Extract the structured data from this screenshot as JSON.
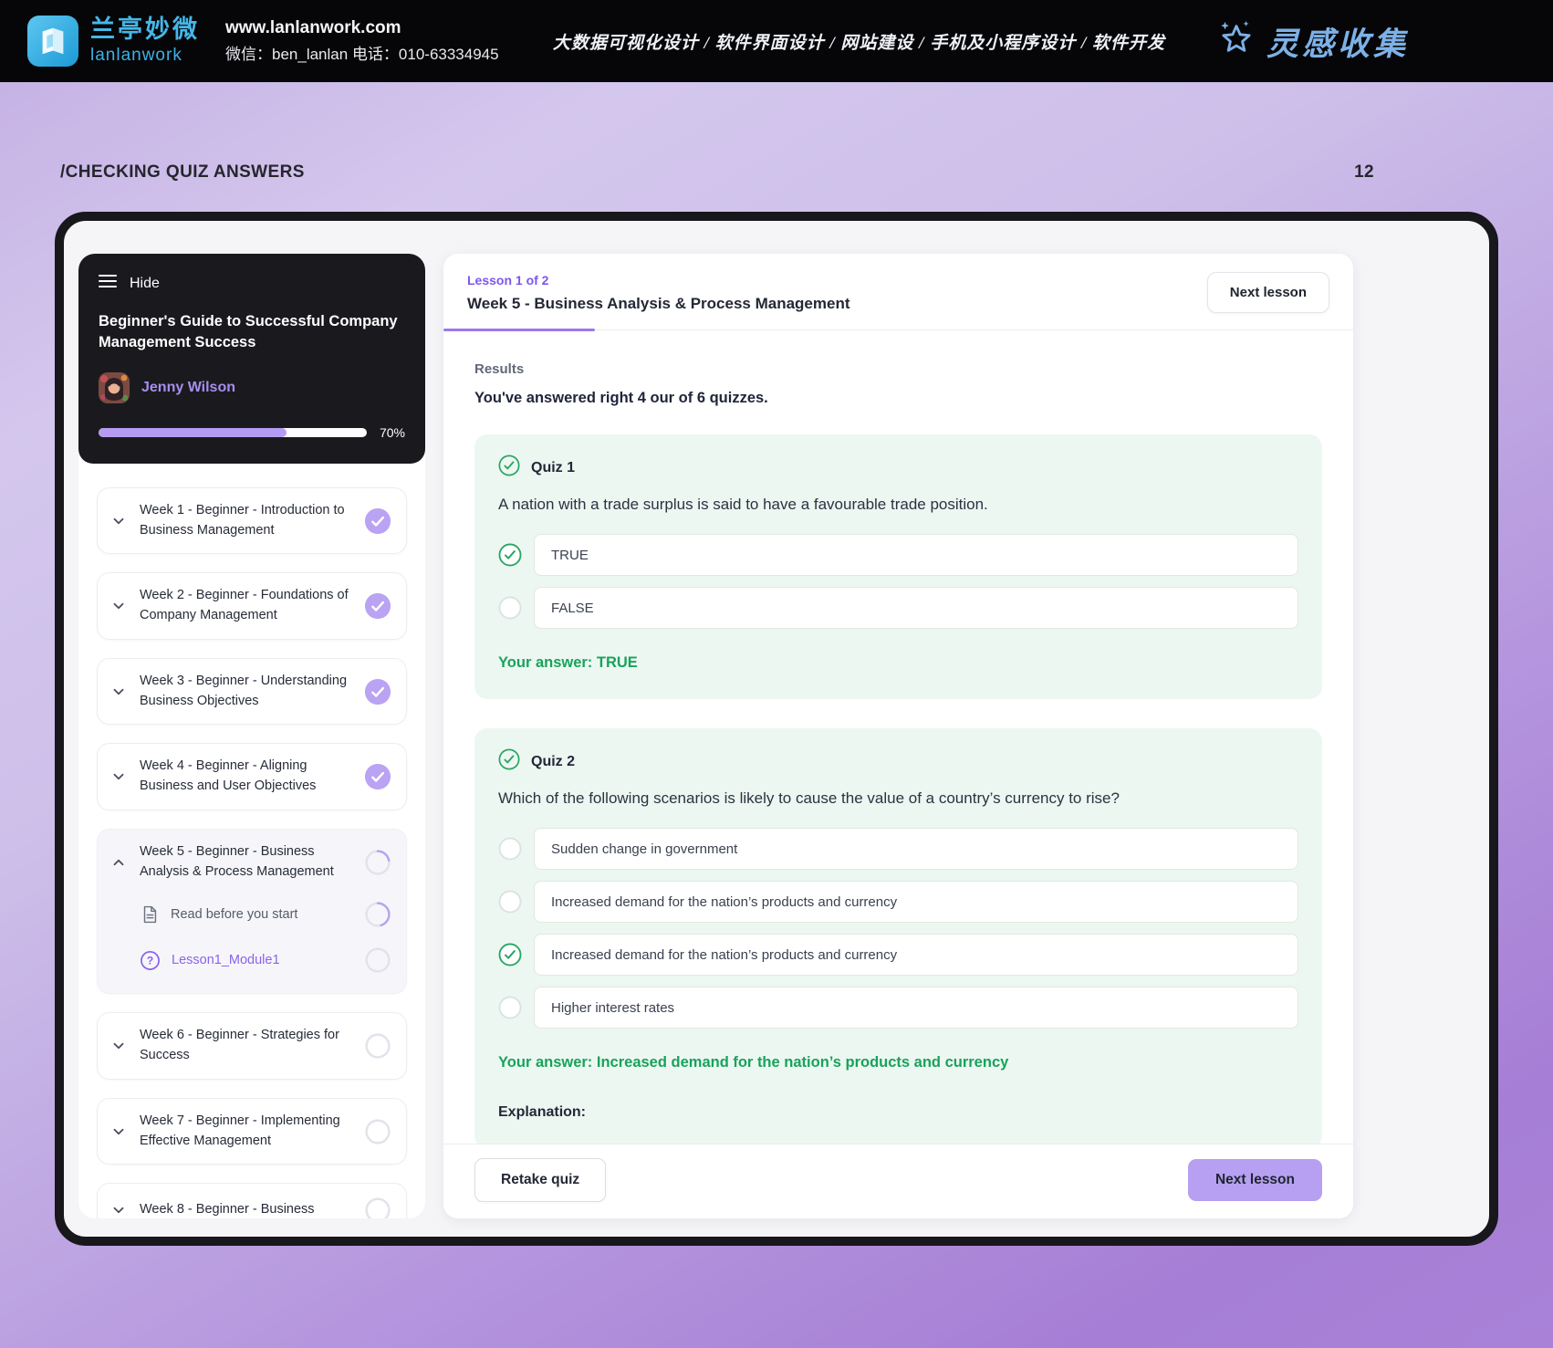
{
  "topbar": {
    "brand_cn": "兰亭妙微",
    "brand_en": "lanlanwork",
    "website": "www.lanlanwork.com",
    "contact": "微信：ben_lanlan    电话：010-63334945",
    "services": "大数据可视化设计 / 软件界面设计 / 网站建设 / 手机及小程序设计 / 软件开发",
    "collect_label": "灵感收集"
  },
  "page_label": "/CHECKING QUIZ ANSWERS",
  "page_number": "12",
  "colors": {
    "accent_purple": "#9b79ee",
    "light_purple": "#b7a0f2",
    "success_green": "#2aa564",
    "answer_green": "#17a35b",
    "quiz_card_bg": "#edf7f1",
    "brand_blue": "#45b7e9",
    "collect_blue": "#7db1e7"
  },
  "sidebar": {
    "hide_label": "Hide",
    "course_title": "Beginner's Guide to Successful Company Management Success",
    "instructor": "Jenny Wilson",
    "progress_value": 70,
    "progress_percent": "70%",
    "weeks": [
      {
        "label": "Week 1 - Beginner - Introduction to Business Management",
        "status": "completed",
        "expanded": false
      },
      {
        "label": "Week 2 - Beginner - Foundations of Company Management",
        "status": "completed",
        "expanded": false
      },
      {
        "label": "Week 3 - Beginner - Understanding Business Objectives",
        "status": "completed",
        "expanded": false
      },
      {
        "label": "Week 4 - Beginner - Aligning Business and User Objectives",
        "status": "completed",
        "expanded": false
      },
      {
        "label": "Week 5 - Beginner - Business Analysis & Process Management",
        "status": "in-progress",
        "progress": 22,
        "expanded": true,
        "children": [
          {
            "label": "Read before you start",
            "icon": "document-icon",
            "progress": 45,
            "accent": false
          },
          {
            "label": "Lesson1_Module1",
            "icon": "question-icon",
            "progress": 0,
            "accent": true
          }
        ]
      },
      {
        "label": "Week 6 - Beginner - Strategies for Success",
        "status": "todo",
        "progress": 0,
        "expanded": false
      },
      {
        "label": "Week 7 - Beginner - Implementing Effective Management",
        "status": "todo",
        "progress": 0,
        "expanded": false
      },
      {
        "label": "Week 8 - Beginner - Business",
        "status": "todo",
        "progress": 0,
        "expanded": false
      }
    ]
  },
  "main": {
    "lesson_label": "Lesson 1 of 2",
    "lesson_title": "Week 5 - Business Analysis & Process Management",
    "next_lesson_top": "Next lesson",
    "results_heading": "Results",
    "results_summary": "You've answered right 4 our of 6 quizzes.",
    "quizzes": [
      {
        "name": "Quiz 1",
        "question": "A nation with a trade surplus is said to have a favourable trade position.",
        "options": [
          {
            "text": "TRUE",
            "selected": true
          },
          {
            "text": "FALSE",
            "selected": false
          }
        ],
        "your_answer": "Your answer: TRUE",
        "explanation_label": ""
      },
      {
        "name": "Quiz 2",
        "question": "Which of the following scenarios is likely to cause the value of a country’s currency to rise?",
        "options": [
          {
            "text": "Sudden change in government",
            "selected": false
          },
          {
            "text": "Increased demand for the nation’s products and currency",
            "selected": false
          },
          {
            "text": "Increased demand for the nation’s products and currency",
            "selected": true
          },
          {
            "text": "Higher interest rates",
            "selected": false
          }
        ],
        "your_answer": "Your answer: Increased demand for the nation’s products and currency",
        "explanation_label": "Explanation:"
      }
    ],
    "retake_label": "Retake quiz",
    "next_lesson_bottom": "Next lesson"
  }
}
